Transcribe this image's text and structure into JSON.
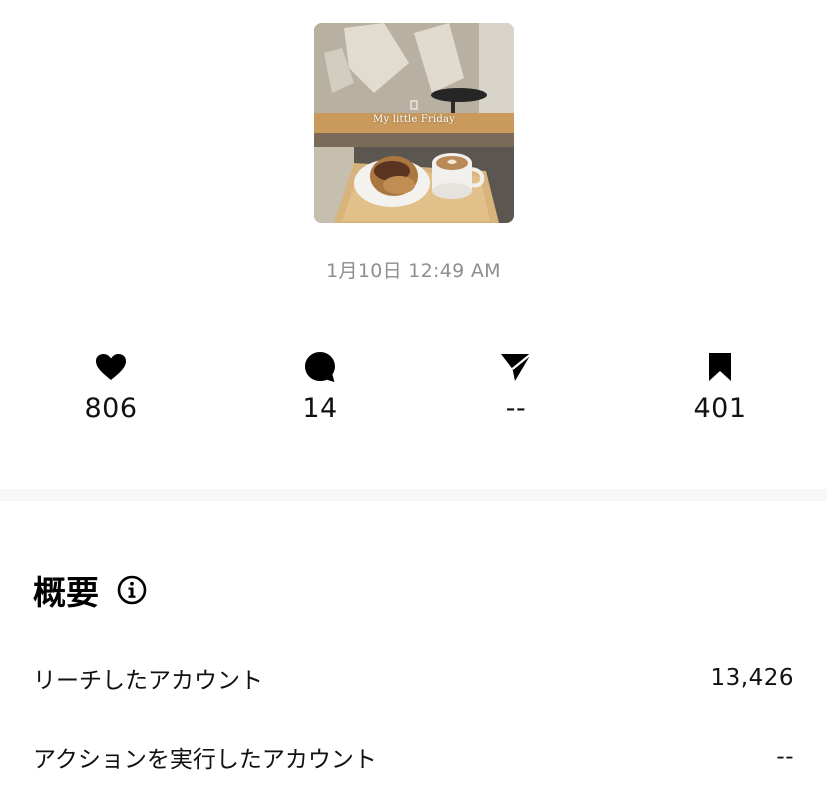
{
  "post": {
    "thumbnail_caption": "My little Friday",
    "timestamp": "1月10日 12:49 AM"
  },
  "stats": {
    "likes": {
      "icon": "heart-icon",
      "value": "806"
    },
    "comments": {
      "icon": "comment-icon",
      "value": "14"
    },
    "shares": {
      "icon": "paper-plane-icon",
      "value": "--"
    },
    "saves": {
      "icon": "bookmark-icon",
      "value": "401"
    }
  },
  "overview": {
    "title": "概要",
    "info_icon": "info-icon",
    "rows": [
      {
        "label": "リーチしたアカウント",
        "value": "13,426"
      },
      {
        "label": "アクションを実行したアカウント",
        "value": "--"
      }
    ]
  },
  "colors": {
    "timestamp": "#8e8e8e",
    "text": "#111111",
    "divider": "#f7f7f7"
  }
}
